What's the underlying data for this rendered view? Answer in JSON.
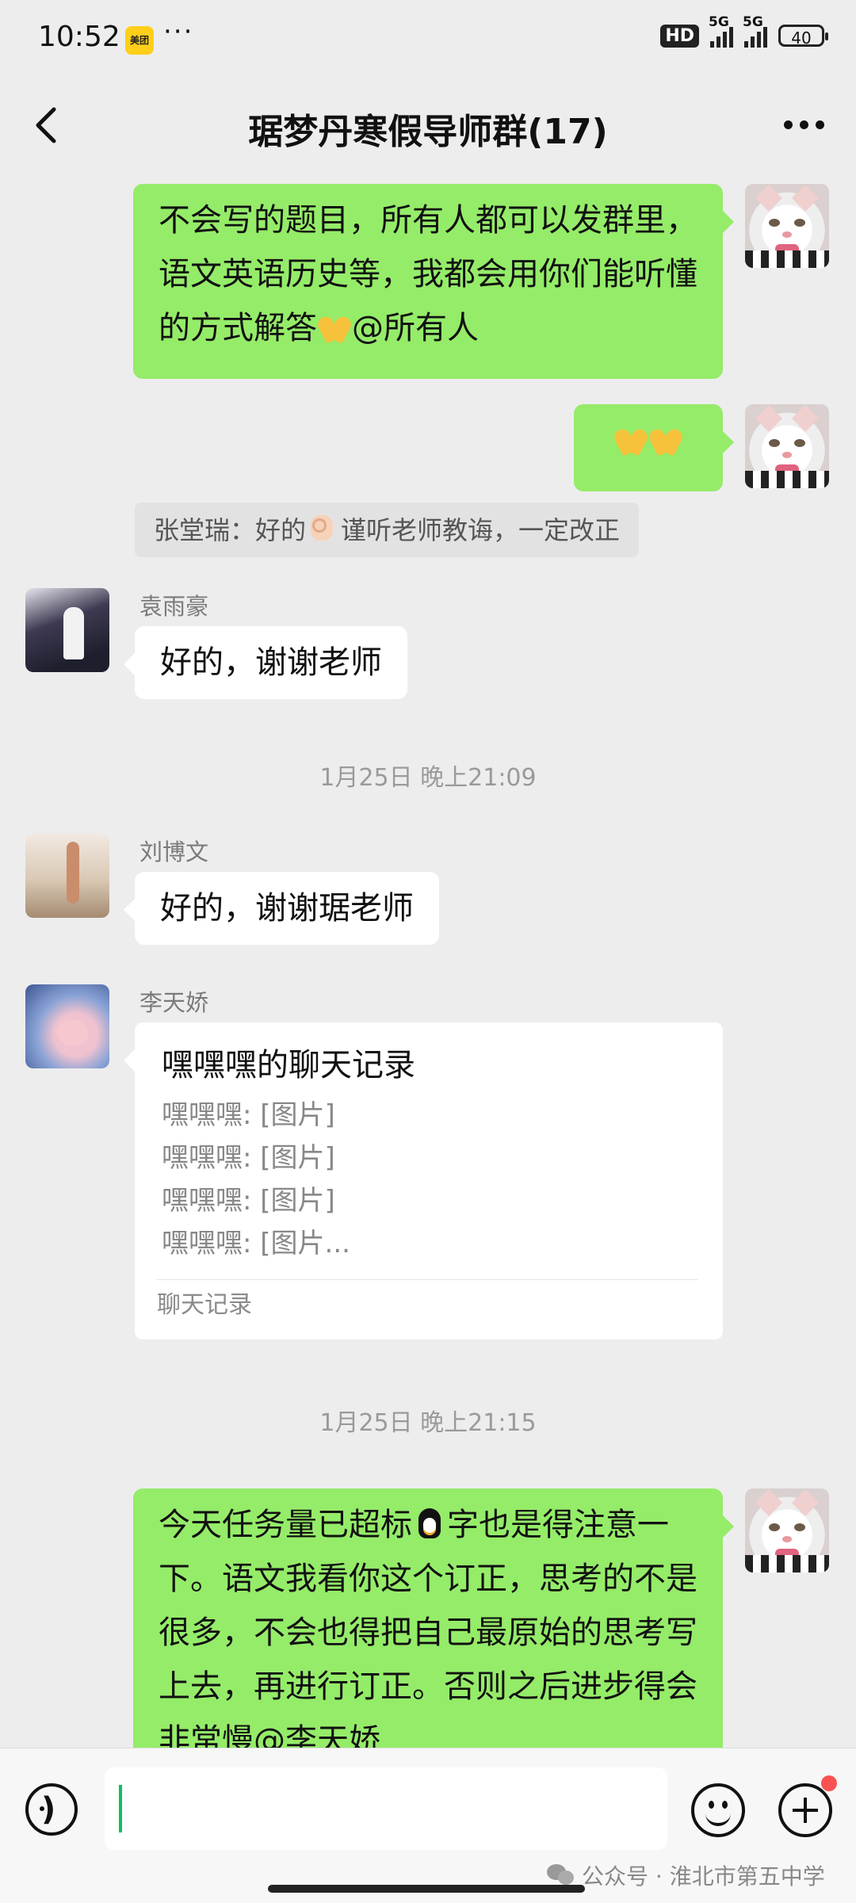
{
  "status_bar": {
    "time": "10:52",
    "app_badge": "美团",
    "more": "···",
    "hd": "HD",
    "sim1": "5G",
    "sim2": "5G",
    "battery": "40"
  },
  "nav": {
    "title": "琚梦丹寒假导师群(17)"
  },
  "messages": [
    {
      "type": "outgoing",
      "text_parts": [
        "不会写的题目，所有人都可以发群里，语文英语历史等，我都会用你们能听懂的方式解答",
        "@所有人"
      ],
      "emoji": "pray"
    },
    {
      "type": "outgoing",
      "emojis": [
        "pray",
        "pray"
      ]
    },
    {
      "type": "quote",
      "text_parts": [
        "张堂瑞：好的",
        "谨听老师教诲，一定改正"
      ],
      "emoji": "ok"
    },
    {
      "type": "incoming",
      "sender": "袁雨豪",
      "text": "好的，谢谢老师"
    },
    {
      "type": "timestamp",
      "text": "1月25日 晚上21:09"
    },
    {
      "type": "incoming",
      "sender": "刘博文",
      "text": "好的，谢谢琚老师"
    },
    {
      "type": "record",
      "sender": "李天娇",
      "title": "嘿嘿嘿的聊天记录",
      "lines": [
        "嘿嘿嘿: [图片]",
        "嘿嘿嘿: [图片]",
        "嘿嘿嘿: [图片]",
        "嘿嘿嘿: [图片..."
      ],
      "footer": "聊天记录"
    },
    {
      "type": "timestamp",
      "text": "1月25日 晚上21:15"
    },
    {
      "type": "outgoing",
      "text_parts": [
        "今天任务量已超标",
        "字也是得注意一下。语文我看你这个订正，思考的不是很多，不会也得把自己最原始的思考写上去，再进行订正。否则之后进步得会非常慢@李天娇"
      ],
      "emoji": "penguin"
    }
  ],
  "input_bar": {
    "watermark": "公众号 · 淮北市第五中学"
  }
}
